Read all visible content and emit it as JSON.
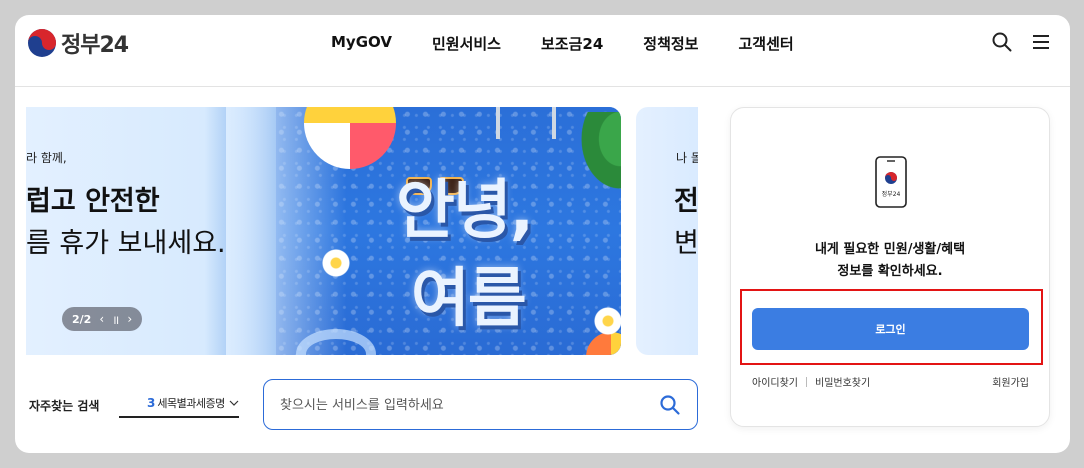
{
  "header": {
    "logo_text": "정부24",
    "nav": [
      "MyGOV",
      "민원서비스",
      "보조금24",
      "정책정보",
      "고객센터"
    ],
    "icons": [
      "search-icon",
      "menu-icon"
    ]
  },
  "banner": {
    "small_text": "라 함께,",
    "line1": "럽고 안전한",
    "line2": "름 휴가 보내세요.",
    "big_line1": "안녕,",
    "big_line2": "여름",
    "pager": {
      "count": "2/2",
      "prev": "‹",
      "pause": "॥",
      "next": "›"
    }
  },
  "banner_next": {
    "small_text": "나 돌",
    "line1": "전",
    "line2": "변"
  },
  "search": {
    "freq_label": "자주찾는 검색",
    "freq_number": "3",
    "freq_value": "세목별과세증명",
    "placeholder": "찾으시는 서비스를 입력하세요"
  },
  "login": {
    "phone_label": "정부24",
    "message_line1": "내게 필요한 민원/생활/혜택",
    "message_line2": "정보를 확인하세요.",
    "button": "로그인",
    "find_id": "아이디찾기",
    "find_pw": "비밀번호찾기",
    "join": "회원가입"
  },
  "colors": {
    "accent": "#3b7de2",
    "highlight": "#e31414",
    "background": "#cfcfcf"
  }
}
